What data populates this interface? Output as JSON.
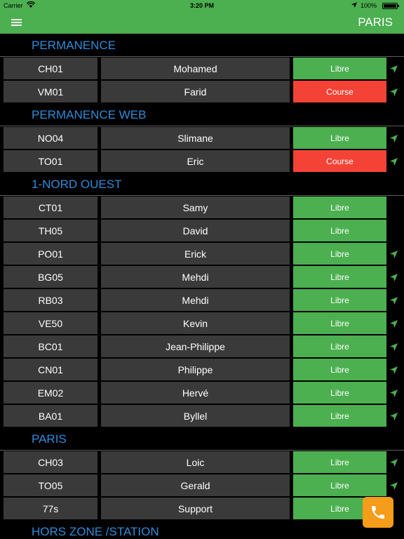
{
  "status_bar": {
    "carrier": "Carrier",
    "time": "3:20 PM",
    "battery": "100%"
  },
  "nav": {
    "title": "PARIS",
    "menu_icon": "hamburger-menu-icon"
  },
  "colors": {
    "accent": "#4caf50",
    "libre": "#4caf50",
    "course": "#f44336",
    "header_text": "#2f8bd8",
    "fab": "#f59c1a"
  },
  "sections": [
    {
      "title": "PERMANENCE",
      "rows": [
        {
          "code": "CH01",
          "name": "Mohamed",
          "status": "Libre",
          "state": "libre",
          "arrow": true
        },
        {
          "code": "VM01",
          "name": "Farid",
          "status": "Course",
          "state": "course",
          "arrow": true
        }
      ]
    },
    {
      "title": "PERMANENCE WEB",
      "rows": [
        {
          "code": "NO04",
          "name": "Slimane",
          "status": "Libre",
          "state": "libre",
          "arrow": true
        },
        {
          "code": "TO01",
          "name": "Eric",
          "status": "Course",
          "state": "course",
          "arrow": true
        }
      ]
    },
    {
      "title": "1-NORD OUEST",
      "rows": [
        {
          "code": "CT01",
          "name": "Samy",
          "status": "Libre",
          "state": "libre",
          "arrow": false
        },
        {
          "code": "TH05",
          "name": "David",
          "status": "Libre",
          "state": "libre",
          "arrow": false
        },
        {
          "code": "PO01",
          "name": "Erick",
          "status": "Libre",
          "state": "libre",
          "arrow": true
        },
        {
          "code": "BG05",
          "name": "Mehdi",
          "status": "Libre",
          "state": "libre",
          "arrow": true
        },
        {
          "code": "RB03",
          "name": "Mehdi",
          "status": "Libre",
          "state": "libre",
          "arrow": true
        },
        {
          "code": "VE50",
          "name": "Kevin",
          "status": "Libre",
          "state": "libre",
          "arrow": true
        },
        {
          "code": "BC01",
          "name": "Jean-Philippe",
          "status": "Libre",
          "state": "libre",
          "arrow": true
        },
        {
          "code": "CN01",
          "name": "Philippe",
          "status": "Libre",
          "state": "libre",
          "arrow": true
        },
        {
          "code": "EM02",
          "name": "Hervé",
          "status": "Libre",
          "state": "libre",
          "arrow": true
        },
        {
          "code": "BA01",
          "name": "Byllel",
          "status": "Libre",
          "state": "libre",
          "arrow": true
        }
      ]
    },
    {
      "title": "PARIS",
      "rows": [
        {
          "code": "CH03",
          "name": "Loic",
          "status": "Libre",
          "state": "libre",
          "arrow": true
        },
        {
          "code": "TO05",
          "name": "Gerald",
          "status": "Libre",
          "state": "libre",
          "arrow": true
        },
        {
          "code": "77s",
          "name": "Support",
          "status": "Libre",
          "state": "libre",
          "arrow": false
        }
      ]
    },
    {
      "title": "HORS ZONE /STATION",
      "rows": []
    }
  ],
  "fab": {
    "icon": "phone-icon"
  }
}
